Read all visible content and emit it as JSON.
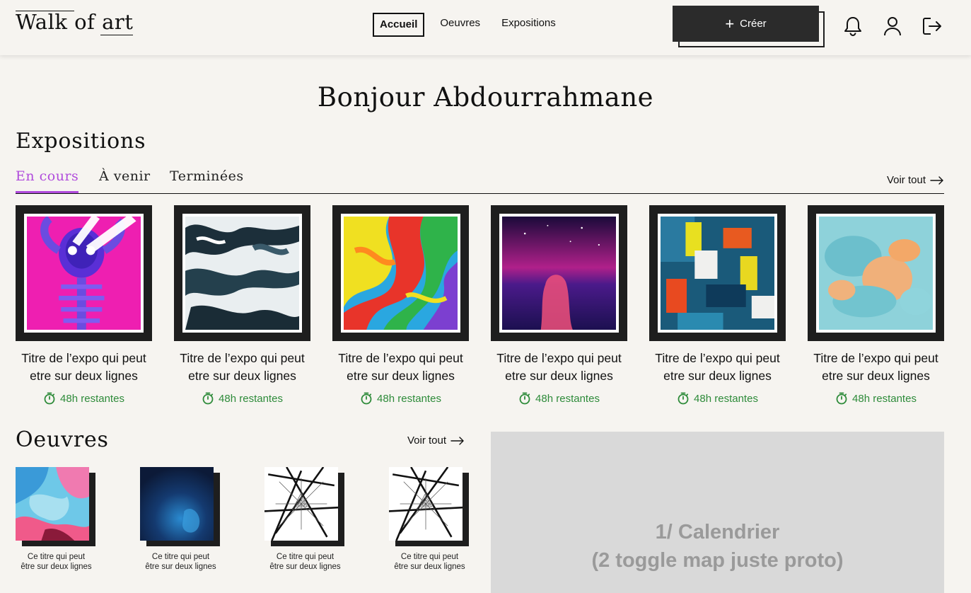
{
  "header": {
    "logo_word1": "Walk",
    "logo_word2": "of",
    "logo_word3": "art",
    "nav": [
      "Accueil",
      "Oeuvres",
      "Expositions"
    ],
    "create_label": "Créer"
  },
  "greeting": "Bonjour Abdourrahmane",
  "expositions": {
    "title": "Expositions",
    "tabs": [
      "En cours",
      "À venir",
      "Terminées"
    ],
    "see_all": "Voir tout",
    "cards": [
      {
        "title": "Titre de l’expo qui peut etre sur deux lignes",
        "time": "48h restantes",
        "image": "neon-skull"
      },
      {
        "title": "Titre de l’expo qui peut etre sur deux lignes",
        "time": "48h restantes",
        "image": "ocean-foam"
      },
      {
        "title": "Titre de l’expo qui peut etre sur deux lignes",
        "time": "48h restantes",
        "image": "rainbow-marble"
      },
      {
        "title": "Titre de l’expo qui peut etre sur deux lignes",
        "time": "48h restantes",
        "image": "purple-night"
      },
      {
        "title": "Titre de l’expo qui peut etre sur deux lignes",
        "time": "48h restantes",
        "image": "abstract-paint"
      },
      {
        "title": "Titre de l’expo qui peut etre sur deux lignes",
        "time": "48h restantes",
        "image": "blue-orange-smoke"
      }
    ]
  },
  "oeuvres": {
    "title": "Oeuvres",
    "see_all": "Voir tout",
    "items": [
      {
        "title_line1": "Ce titre qui peut",
        "title_line2": "être sur deux lignes",
        "image": "pink-blue-paint"
      },
      {
        "title_line1": "Ce titre qui peut",
        "title_line2": "être sur deux lignes",
        "image": "dark-blue-ink"
      },
      {
        "title_line1": "Ce titre qui peut",
        "title_line2": "être sur deux lignes",
        "image": "geometric-lines"
      },
      {
        "title_line1": "Ce titre qui peut",
        "title_line2": "être sur deux lignes",
        "image": "geometric-lines"
      }
    ]
  },
  "calendar_placeholder": {
    "line1": "1/ Calendrier",
    "line2": "(2 toggle map juste proto)"
  },
  "colors": {
    "accent": "#b04bdc",
    "timer_green": "#2e8b3a",
    "dark": "#1e1e1e",
    "background": "#f6f4f0"
  }
}
